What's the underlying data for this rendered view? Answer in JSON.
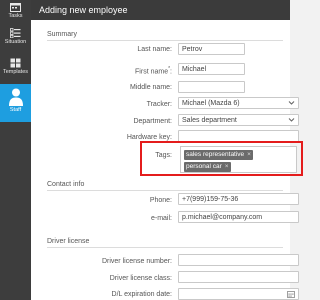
{
  "sidebar": {
    "items": [
      {
        "label": "Tasks",
        "icon": "calendar-icon",
        "active": false
      },
      {
        "label": "Situation",
        "icon": "checklist-icon",
        "active": false
      },
      {
        "label": "Templates",
        "icon": "templates-icon",
        "active": false
      },
      {
        "label": "Staff",
        "icon": "person-icon",
        "active": true
      }
    ]
  },
  "header": {
    "title": "Adding new employee"
  },
  "summary": {
    "title": "Summary",
    "last_name": {
      "label": "Last name:",
      "value": "Petrov"
    },
    "first_name": {
      "label": "First name",
      "required_mark": "*",
      "colon": ":",
      "value": "Michael"
    },
    "middle_name": {
      "label": "Middle name:",
      "value": ""
    },
    "tracker": {
      "label": "Tracker:",
      "value": "Michael (Mazda 6)"
    },
    "department": {
      "label": "Department:",
      "value": "Sales department"
    },
    "hardware_key": {
      "label": "Hardware key:",
      "value": ""
    },
    "tags": {
      "label": "Tags:",
      "items": [
        "sales representative",
        "personal car"
      ],
      "remove_glyph": "×"
    }
  },
  "contact": {
    "title": "Contact info",
    "phone": {
      "label": "Phone:",
      "value": "+7(999)159-75-36"
    },
    "email": {
      "label": "e-mail:",
      "value": "p.michael@company.com"
    }
  },
  "license": {
    "title": "Driver license",
    "number": {
      "label": "Driver license number:",
      "value": ""
    },
    "class": {
      "label": "Driver license class:",
      "value": ""
    },
    "expiration": {
      "label": "D/L expiration date:",
      "value": ""
    }
  },
  "colors": {
    "sidebar_bg": "#3d3d3d",
    "accent": "#1e9ee0",
    "header_bg": "#3b3b3b",
    "highlight": "#e41c1c",
    "tag_bg": "#6b6b6b"
  }
}
